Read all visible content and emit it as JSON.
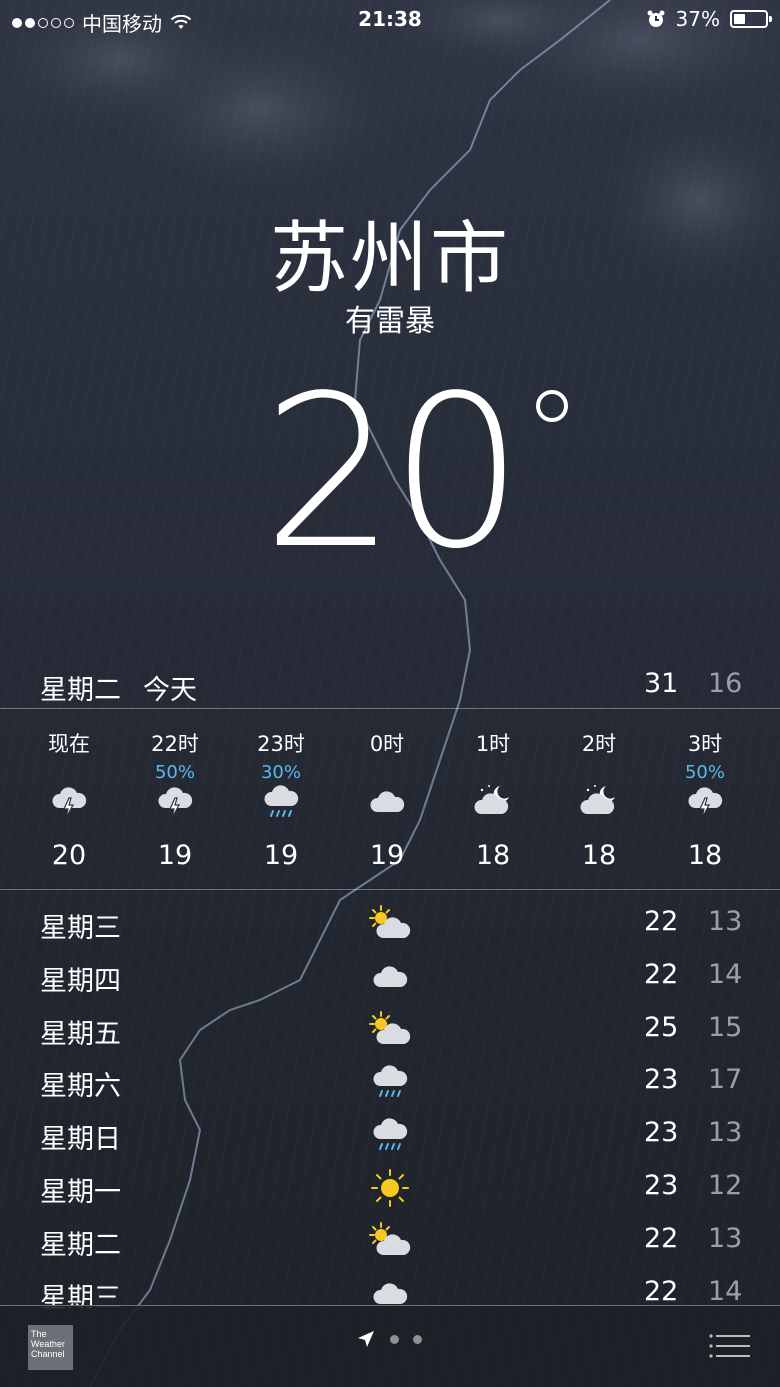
{
  "status_bar": {
    "carrier": "中国移动",
    "time": "21:38",
    "battery": "37%",
    "battery_level": 0.37,
    "signal_bars": 2
  },
  "location": {
    "city": "苏州市",
    "condition": "有雷暴",
    "temperature": "20"
  },
  "today": {
    "day": "星期二",
    "label": "今天",
    "high": "31",
    "low": "16"
  },
  "hourly": [
    {
      "time": "现在",
      "precip": "",
      "icon": "thunderstorm-icon",
      "temp": "20"
    },
    {
      "time": "22时",
      "precip": "50%",
      "icon": "thunderstorm-icon",
      "temp": "19"
    },
    {
      "time": "23时",
      "precip": "30%",
      "icon": "rain-icon",
      "temp": "19"
    },
    {
      "time": "0时",
      "precip": "",
      "icon": "cloud-icon",
      "temp": "19"
    },
    {
      "time": "1时",
      "precip": "",
      "icon": "partly-cloudy-night-icon",
      "temp": "18"
    },
    {
      "time": "2时",
      "precip": "",
      "icon": "partly-cloudy-night-icon",
      "temp": "18"
    },
    {
      "time": "3时",
      "precip": "50%",
      "icon": "thunderstorm-icon",
      "temp": "18"
    }
  ],
  "daily": [
    {
      "day": "星期三",
      "icon": "partly-sunny-icon",
      "high": "22",
      "low": "13"
    },
    {
      "day": "星期四",
      "icon": "cloud-icon",
      "high": "22",
      "low": "14"
    },
    {
      "day": "星期五",
      "icon": "partly-sunny-icon",
      "high": "25",
      "low": "15"
    },
    {
      "day": "星期六",
      "icon": "rain-icon",
      "high": "23",
      "low": "17"
    },
    {
      "day": "星期日",
      "icon": "rain-icon",
      "high": "23",
      "low": "13"
    },
    {
      "day": "星期一",
      "icon": "sun-icon",
      "high": "23",
      "low": "12"
    },
    {
      "day": "星期二",
      "icon": "partly-sunny-icon",
      "high": "22",
      "low": "13"
    },
    {
      "day": "星期三",
      "icon": "cloud-icon",
      "high": "22",
      "low": "14"
    }
  ],
  "bottom_bar": {
    "logo_text": [
      "The",
      "Weather",
      "Channel"
    ],
    "page_count": 2
  },
  "colors": {
    "precip": "#5bb8ee",
    "low_temp": "#9aa0ab",
    "sun": "#f7c81e"
  }
}
